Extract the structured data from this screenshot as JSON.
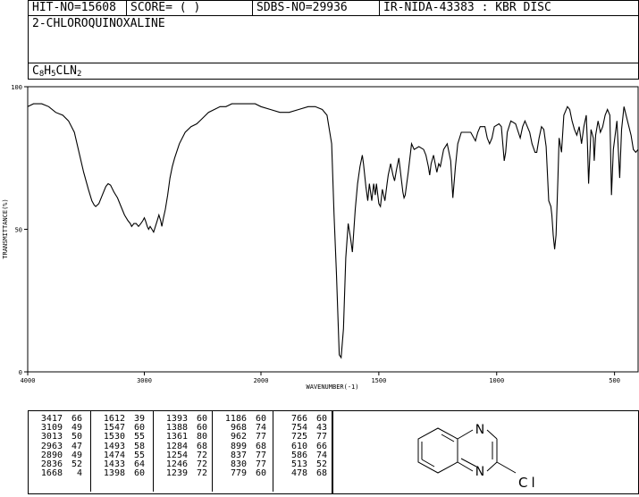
{
  "header": {
    "hit_no": "HIT-NO=15608",
    "score": "SCORE=  (  )",
    "sdbs_no": "SDBS-NO=29936",
    "ir_nida": "IR-NIDA-43383 : KBR DISC"
  },
  "compound": {
    "name": "2-CHLOROQUINOXALINE",
    "formula_parts": [
      "C",
      "8",
      "H",
      "5",
      "CLN",
      "2"
    ]
  },
  "chart_data": {
    "type": "line",
    "xlabel": "WAVENUMBER(-1)",
    "ylabel": "TRANSMITTANCE(%)",
    "xlim": [
      4000,
      400
    ],
    "ylim": [
      0,
      100
    ],
    "x_ticks": [
      4000,
      3000,
      2000,
      1500,
      1000,
      500
    ],
    "y_ticks": [
      0,
      50,
      100
    ],
    "grid": false,
    "series": [
      {
        "points": [
          [
            4000,
            93
          ],
          [
            3950,
            94
          ],
          [
            3880,
            94
          ],
          [
            3820,
            93
          ],
          [
            3760,
            91
          ],
          [
            3700,
            90
          ],
          [
            3650,
            88
          ],
          [
            3600,
            84
          ],
          [
            3560,
            77
          ],
          [
            3520,
            70
          ],
          [
            3480,
            64
          ],
          [
            3450,
            60
          ],
          [
            3430,
            58.5
          ],
          [
            3417,
            58
          ],
          [
            3390,
            59
          ],
          [
            3360,
            62
          ],
          [
            3330,
            65
          ],
          [
            3310,
            66
          ],
          [
            3290,
            65.5
          ],
          [
            3260,
            63
          ],
          [
            3230,
            61
          ],
          [
            3200,
            58
          ],
          [
            3170,
            55
          ],
          [
            3140,
            53
          ],
          [
            3120,
            52
          ],
          [
            3109,
            51
          ],
          [
            3090,
            52
          ],
          [
            3070,
            52
          ],
          [
            3050,
            51
          ],
          [
            3030,
            52
          ],
          [
            3013,
            53
          ],
          [
            3000,
            54
          ],
          [
            2990,
            53
          ],
          [
            2975,
            51
          ],
          [
            2963,
            50
          ],
          [
            2950,
            51
          ],
          [
            2935,
            50
          ],
          [
            2920,
            49
          ],
          [
            2905,
            51
          ],
          [
            2890,
            53
          ],
          [
            2875,
            55
          ],
          [
            2860,
            53
          ],
          [
            2850,
            51
          ],
          [
            2836,
            54
          ],
          [
            2820,
            57
          ],
          [
            2800,
            62
          ],
          [
            2780,
            68
          ],
          [
            2760,
            72
          ],
          [
            2740,
            75
          ],
          [
            2700,
            80
          ],
          [
            2650,
            84
          ],
          [
            2600,
            86
          ],
          [
            2550,
            87
          ],
          [
            2500,
            89
          ],
          [
            2450,
            91
          ],
          [
            2400,
            92
          ],
          [
            2350,
            93
          ],
          [
            2300,
            93
          ],
          [
            2250,
            94
          ],
          [
            2200,
            94
          ],
          [
            2150,
            94
          ],
          [
            2100,
            94
          ],
          [
            2050,
            94
          ],
          [
            2000,
            93
          ],
          [
            1960,
            92
          ],
          [
            1920,
            91
          ],
          [
            1880,
            91
          ],
          [
            1840,
            92
          ],
          [
            1800,
            93
          ],
          [
            1770,
            93
          ],
          [
            1740,
            92
          ],
          [
            1720,
            90
          ],
          [
            1700,
            80
          ],
          [
            1690,
            55
          ],
          [
            1680,
            35
          ],
          [
            1668,
            6
          ],
          [
            1660,
            5
          ],
          [
            1650,
            15
          ],
          [
            1640,
            40
          ],
          [
            1630,
            52
          ],
          [
            1620,
            47
          ],
          [
            1612,
            42
          ],
          [
            1600,
            57
          ],
          [
            1590,
            66
          ],
          [
            1580,
            72
          ],
          [
            1570,
            76
          ],
          [
            1565,
            73
          ],
          [
            1555,
            65
          ],
          [
            1547,
            60
          ],
          [
            1540,
            66
          ],
          [
            1530,
            60
          ],
          [
            1522,
            66
          ],
          [
            1515,
            62
          ],
          [
            1510,
            66
          ],
          [
            1500,
            59
          ],
          [
            1493,
            58
          ],
          [
            1485,
            64
          ],
          [
            1474,
            60
          ],
          [
            1465,
            66
          ],
          [
            1460,
            69
          ],
          [
            1450,
            73
          ],
          [
            1440,
            69
          ],
          [
            1433,
            67
          ],
          [
            1425,
            71
          ],
          [
            1415,
            75
          ],
          [
            1405,
            68
          ],
          [
            1398,
            63
          ],
          [
            1393,
            61
          ],
          [
            1388,
            62
          ],
          [
            1375,
            70
          ],
          [
            1361,
            80
          ],
          [
            1350,
            78
          ],
          [
            1330,
            79
          ],
          [
            1310,
            78
          ],
          [
            1300,
            76
          ],
          [
            1290,
            72
          ],
          [
            1284,
            69
          ],
          [
            1278,
            73
          ],
          [
            1268,
            76
          ],
          [
            1254,
            70
          ],
          [
            1246,
            73
          ],
          [
            1239,
            72
          ],
          [
            1225,
            78
          ],
          [
            1210,
            80
          ],
          [
            1195,
            74
          ],
          [
            1186,
            61
          ],
          [
            1175,
            72
          ],
          [
            1165,
            80
          ],
          [
            1150,
            84
          ],
          [
            1130,
            84
          ],
          [
            1110,
            84
          ],
          [
            1090,
            81
          ],
          [
            1080,
            84
          ],
          [
            1070,
            86
          ],
          [
            1050,
            86
          ],
          [
            1040,
            82
          ],
          [
            1030,
            80
          ],
          [
            1020,
            82
          ],
          [
            1010,
            86
          ],
          [
            990,
            87
          ],
          [
            980,
            86
          ],
          [
            968,
            74
          ],
          [
            962,
            77
          ],
          [
            955,
            84
          ],
          [
            940,
            88
          ],
          [
            920,
            87
          ],
          [
            900,
            82
          ],
          [
            890,
            86
          ],
          [
            880,
            88
          ],
          [
            860,
            84
          ],
          [
            850,
            80
          ],
          [
            837,
            77
          ],
          [
            830,
            77
          ],
          [
            820,
            82
          ],
          [
            810,
            86
          ],
          [
            800,
            85
          ],
          [
            790,
            79
          ],
          [
            779,
            60
          ],
          [
            770,
            58
          ],
          [
            766,
            55
          ],
          [
            760,
            48
          ],
          [
            754,
            43
          ],
          [
            748,
            48
          ],
          [
            740,
            68
          ],
          [
            735,
            82
          ],
          [
            725,
            77
          ],
          [
            715,
            90
          ],
          [
            700,
            93
          ],
          [
            690,
            92
          ],
          [
            680,
            88
          ],
          [
            670,
            85
          ],
          [
            660,
            83
          ],
          [
            650,
            86
          ],
          [
            640,
            80
          ],
          [
            630,
            86
          ],
          [
            620,
            90
          ],
          [
            615,
            80
          ],
          [
            610,
            66
          ],
          [
            600,
            85
          ],
          [
            590,
            82
          ],
          [
            586,
            74
          ],
          [
            580,
            83
          ],
          [
            570,
            88
          ],
          [
            560,
            84
          ],
          [
            550,
            86
          ],
          [
            540,
            90
          ],
          [
            530,
            92
          ],
          [
            520,
            90
          ],
          [
            513,
            62
          ],
          [
            505,
            78
          ],
          [
            490,
            88
          ],
          [
            478,
            68
          ],
          [
            470,
            85
          ],
          [
            460,
            93
          ],
          [
            445,
            88
          ],
          [
            430,
            83
          ],
          [
            420,
            78
          ],
          [
            410,
            77
          ],
          [
            400,
            78
          ]
        ]
      }
    ]
  },
  "peaks_table": {
    "columns": [
      {
        "wn": [
          "3417",
          "3109",
          "3013",
          "2963",
          "2890",
          "2836",
          "1668"
        ],
        "t": [
          "66",
          "49",
          "50",
          "47",
          "49",
          "52",
          "4"
        ]
      },
      {
        "wn": [
          "1612",
          "1547",
          "1530",
          "1493",
          "1474",
          "1433",
          "1398"
        ],
        "t": [
          "39",
          "60",
          "55",
          "58",
          "55",
          "64",
          "60"
        ]
      },
      {
        "wn": [
          "1393",
          "1388",
          "1361",
          "1284",
          "1254",
          "1246",
          "1239"
        ],
        "t": [
          "60",
          "60",
          "80",
          "68",
          "72",
          "72",
          "72"
        ]
      },
      {
        "wn": [
          "1186",
          "968",
          "962",
          "899",
          "837",
          "830",
          "779"
        ],
        "t": [
          "60",
          "74",
          "77",
          "68",
          "77",
          "77",
          "60"
        ]
      },
      {
        "wn": [
          "766",
          "754",
          "725",
          "610",
          "586",
          "513",
          "478"
        ],
        "t": [
          "60",
          "43",
          "77",
          "66",
          "74",
          "52",
          "68"
        ]
      }
    ]
  },
  "structure": {
    "atoms": [
      "N",
      "N",
      "Cl"
    ]
  }
}
